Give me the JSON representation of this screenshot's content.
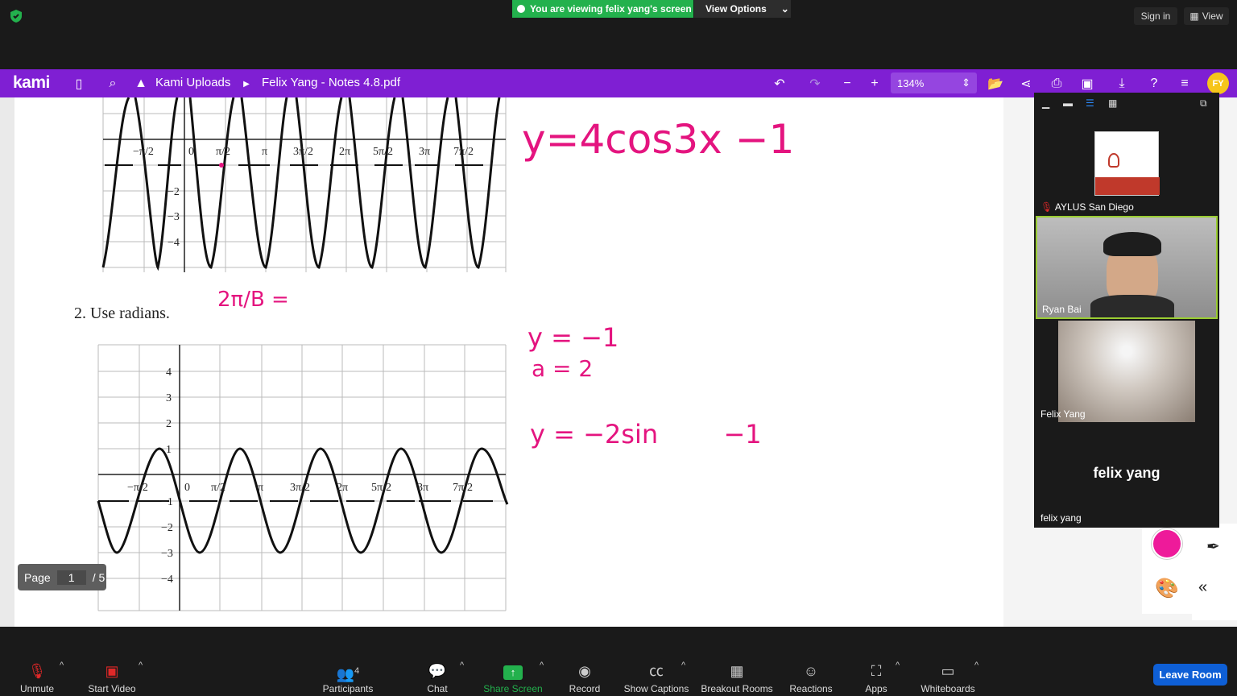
{
  "zoom_meeting": {
    "viewing_banner": "You are viewing felix yang's screen",
    "view_options": "View Options",
    "sign_in": "Sign in",
    "view": "View"
  },
  "kami": {
    "logo": "kami",
    "breadcrumb": "Kami Uploads",
    "filename": "Felix Yang - Notes 4.8.pdf",
    "zoom": "134%",
    "avatar_initials": "FY",
    "page_label": "Page",
    "page_current": "1",
    "page_total": "/ 5"
  },
  "worksheet": {
    "q2": "2.   Use radians."
  },
  "graph1_ticks": [
    "−π/2",
    "0",
    "π/2",
    "π",
    "3π/2",
    "2π",
    "5π/2",
    "3π",
    "7π/2"
  ],
  "graph1_yticks": [
    "−2",
    "−3",
    "−4"
  ],
  "graph2_xticks": [
    "−π/2",
    "0",
    "π/2",
    "π",
    "3π/2",
    "2π",
    "5π/2",
    "3π",
    "7π/2"
  ],
  "graph2_yticks": [
    "4",
    "3",
    "2",
    "1",
    "−1",
    "−2",
    "−3",
    "−4"
  ],
  "handwriting": {
    "eq1": "y=4cos3x  −1",
    "frac": "2π/B =",
    "eq2a": "y = −1",
    "eq2b": "a = 2",
    "eq2c": "y = −2sin        −1"
  },
  "participants_gallery": {
    "tiles": [
      {
        "name": "AYLUS San Diego",
        "muted": true
      },
      {
        "name": "Ryan Bai",
        "muted": false
      },
      {
        "name": "Felix Yang",
        "muted": false
      },
      {
        "name": "felix yang",
        "display": "felix yang",
        "muted": false
      }
    ]
  },
  "toolbar": {
    "unmute": "Unmute",
    "start_video": "Start Video",
    "participants": "Participants",
    "participants_count": "4",
    "chat": "Chat",
    "share_screen": "Share Screen",
    "record": "Record",
    "show_captions": "Show Captions",
    "breakout_rooms": "Breakout Rooms",
    "reactions": "Reactions",
    "apps": "Apps",
    "whiteboards": "Whiteboards",
    "leave_room": "Leave Room"
  },
  "colors": {
    "kami_purple": "#7f1fd3",
    "zoom_green": "#23b14d",
    "leave_blue": "#0e5fd6",
    "ink_pink": "#e4147f"
  }
}
